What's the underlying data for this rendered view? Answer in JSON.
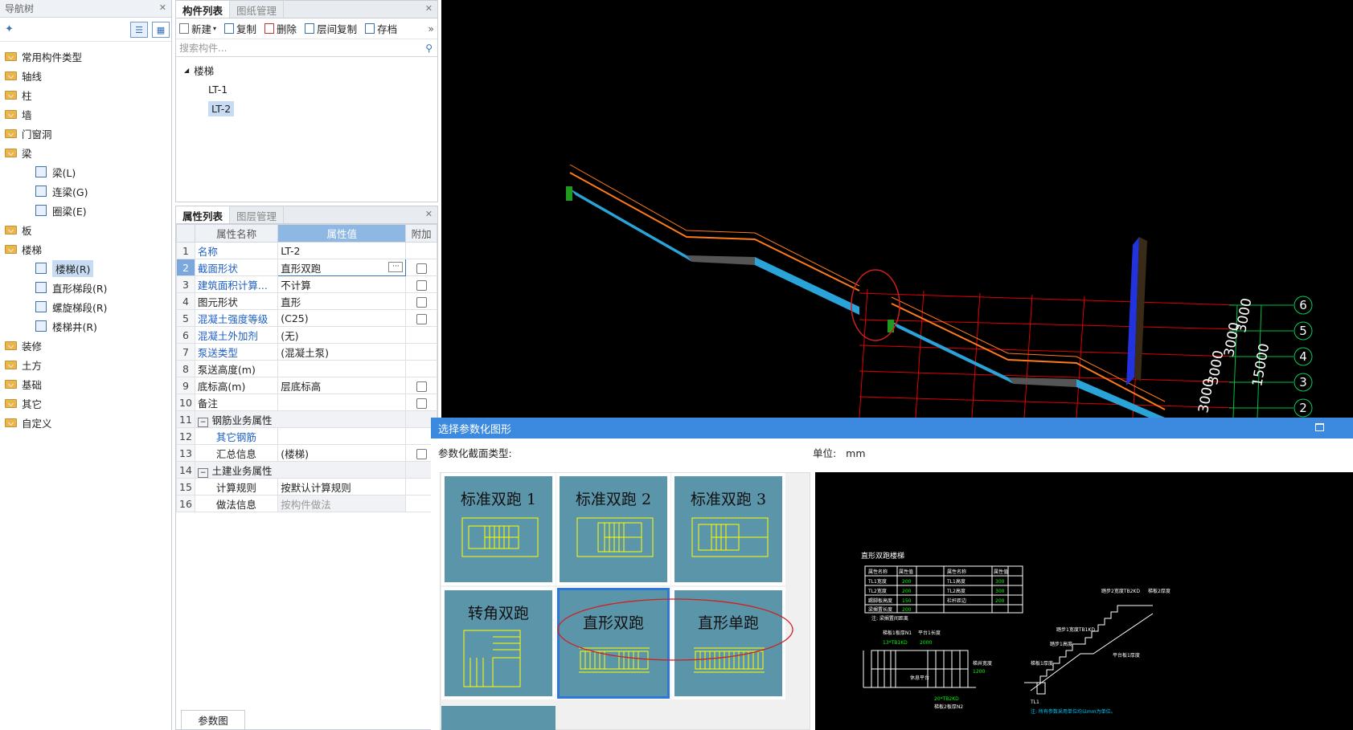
{
  "nav": {
    "title": "导航树",
    "items": [
      {
        "label": "常用构件类型"
      },
      {
        "label": "轴线"
      },
      {
        "label": "柱"
      },
      {
        "label": "墙"
      },
      {
        "label": "门窗洞"
      },
      {
        "label": "梁"
      }
    ],
    "beam_children": [
      "梁(L)",
      "连梁(G)",
      "圈梁(E)"
    ],
    "items2": [
      {
        "label": "板"
      },
      {
        "label": "楼梯"
      }
    ],
    "stair_children": [
      "楼梯(R)",
      "直形梯段(R)",
      "螺旋梯段(R)",
      "楼梯井(R)"
    ],
    "items3": [
      {
        "label": "装修"
      },
      {
        "label": "土方"
      },
      {
        "label": "基础"
      },
      {
        "label": "其它"
      },
      {
        "label": "自定义"
      }
    ]
  },
  "components": {
    "tabs": [
      "构件列表",
      "图纸管理"
    ],
    "toolbar": [
      "新建",
      "复制",
      "删除",
      "层间复制",
      "存档"
    ],
    "search_placeholder": "搜索构件...",
    "root": "楼梯",
    "children": [
      "LT-1",
      "LT-2"
    ]
  },
  "properties": {
    "tabs": [
      "属性列表",
      "图层管理"
    ],
    "headers": {
      "name": "属性名称",
      "value": "属性值",
      "extra": "附加"
    },
    "rows": [
      {
        "n": "1",
        "name": "名称",
        "value": "LT-2"
      },
      {
        "n": "2",
        "name": "截面形状",
        "value": "直形双跑"
      },
      {
        "n": "3",
        "name": "建筑面积计算...",
        "value": "不计算"
      },
      {
        "n": "4",
        "name": "图元形状",
        "value": "直形"
      },
      {
        "n": "5",
        "name": "混凝土强度等级",
        "value": "(C25)"
      },
      {
        "n": "6",
        "name": "混凝土外加剂",
        "value": "(无)"
      },
      {
        "n": "7",
        "name": "泵送类型",
        "value": "(混凝土泵)"
      },
      {
        "n": "8",
        "name": "泵送高度(m)",
        "value": ""
      },
      {
        "n": "9",
        "name": "底标高(m)",
        "value": "层底标高"
      },
      {
        "n": "10",
        "name": "备注",
        "value": ""
      },
      {
        "n": "11",
        "name": "钢筋业务属性",
        "value": ""
      },
      {
        "n": "12",
        "name": "其它钢筋",
        "value": ""
      },
      {
        "n": "13",
        "name": "汇总信息",
        "value": "(楼梯)"
      },
      {
        "n": "14",
        "name": "土建业务属性",
        "value": ""
      },
      {
        "n": "15",
        "name": "计算规则",
        "value": "按默认计算规则"
      },
      {
        "n": "16",
        "name": "做法信息",
        "value": "按构件做法"
      }
    ],
    "bottom_tab": "参数图"
  },
  "viewport": {
    "axis_labels": [
      "6",
      "5",
      "4",
      "3",
      "2"
    ],
    "dims": [
      "3000",
      "3000",
      "15000",
      "3000",
      "3000"
    ]
  },
  "dialog": {
    "title": "选择参数化图形",
    "type_label": "参数化截面类型:",
    "unit_label": "单位:",
    "unit_value": "mm",
    "options": [
      "标准双跑 1",
      "标准双跑 2",
      "标准双跑 3",
      "转角双跑",
      "直形双跑",
      "直形单跑"
    ],
    "selected": "直形双跑",
    "preview": {
      "title": "直形双跑楼梯",
      "table_headers": [
        "属性名称",
        "属性值",
        "属性名称",
        "属性值"
      ],
      "table_rows": [
        [
          "TL1宽度",
          "200",
          "TL1高度",
          "300"
        ],
        [
          "TL2宽度",
          "200",
          "TL2高度",
          "300"
        ],
        [
          "踢脚板高度",
          "150",
          "栏杆距边",
          "200"
        ],
        [
          "梁搁置长度",
          "200",
          "",
          ""
        ]
      ],
      "note": "注: 梁搁置间距离",
      "labels": [
        "梯板1板厚N1",
        "平台1长度",
        "13*TB1KD",
        "2000",
        "梯井宽度",
        "1200",
        "休息平台",
        "20*TB2KD",
        "梯板2板厚N2",
        "踏步2宽度TB2KD",
        "梯板2厚度",
        "梯板1厚度",
        "平台板1厚度",
        "踏步1高度",
        "踏步1宽度TB1KD",
        "TL1",
        "注: 所有参数采用单位均以mm为单位。"
      ]
    }
  },
  "colors": {
    "accent": "#3c8ae0",
    "card_bg": "#5b95aa",
    "card_line": "#ffff00"
  }
}
